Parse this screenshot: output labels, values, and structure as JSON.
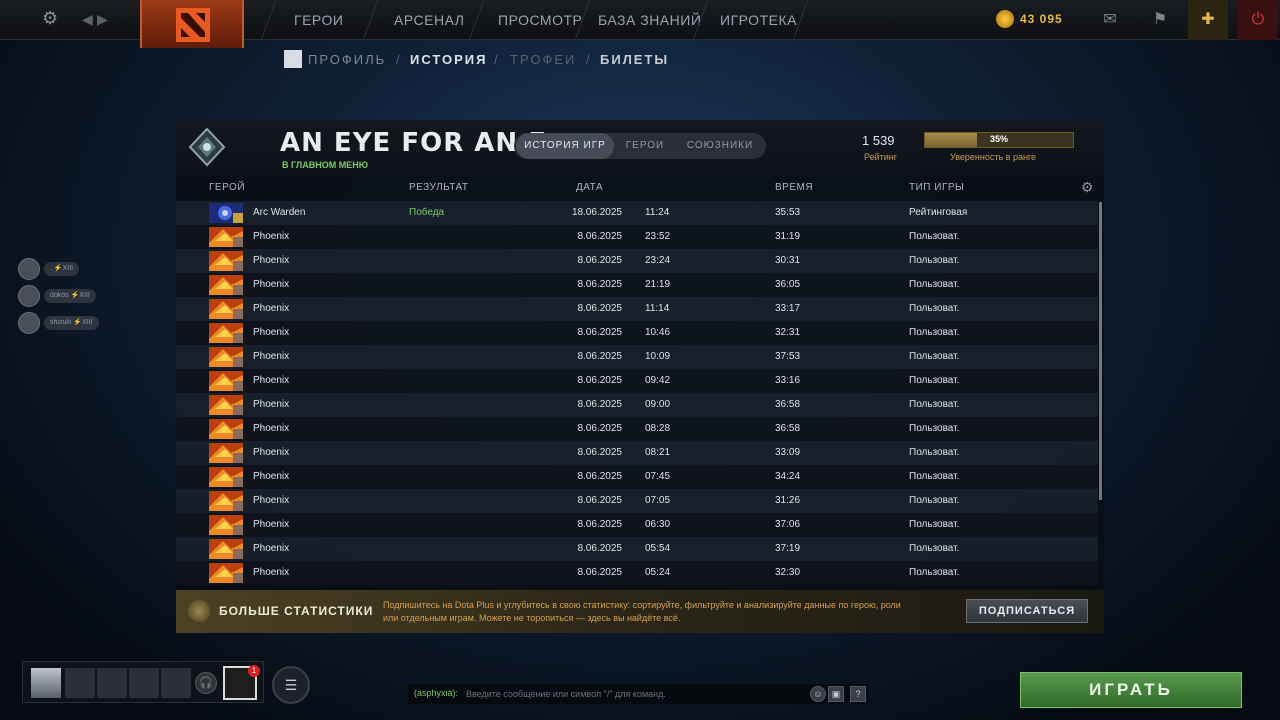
{
  "topbar": {
    "nav": [
      "ГЕРОИ",
      "АРСЕНАЛ",
      "ПРОСМОТР",
      "БАЗА ЗНАНИЙ",
      "ИГРОТЕКА"
    ],
    "shards": "43 095",
    "settings_icon": "gear-icon",
    "logo_icon": "dota-logo",
    "mail_icon": "mail-icon",
    "armory_icon": "banner-icon",
    "plus_icon": "dota-plus-icon",
    "power_icon": "power-icon"
  },
  "subnav": [
    "ПРОФИЛЬ",
    "/",
    "ИСТОРИЯ",
    "/",
    "ТРОФЕИ",
    "/",
    "БИЛЕТЫ"
  ],
  "profile": {
    "name": "AN EYE FOR AN E ...",
    "status": "В ГЛАВНОМ МЕНЮ",
    "tabs": [
      "ИСТОРИЯ ИГР",
      "ГЕРОИ",
      "СОЮЗНИКИ"
    ],
    "active_tab": 0,
    "rating_value": "1 539",
    "rating_label": "Рейтинг",
    "confidence_percent": 35,
    "confidence_text": "35%",
    "confidence_label": "Уверенность в ранге"
  },
  "table": {
    "headers": [
      "ГЕРОЙ",
      "РЕЗУЛЬТАТ",
      "ДАТА",
      "ВРЕМЯ",
      "ТИП ИГРЫ"
    ],
    "rows": [
      {
        "hero": "Arc Warden",
        "result": "Победа",
        "date": "18.06.2025",
        "time": "11:24",
        "duration": "35:53",
        "mode": "Рейтинговая"
      },
      {
        "hero": "Phoenix",
        "result": "",
        "date": "8.06.2025",
        "time": "23:52",
        "duration": "31:19",
        "mode": "Пользоват."
      },
      {
        "hero": "Phoenix",
        "result": "",
        "date": "8.06.2025",
        "time": "23:24",
        "duration": "30:31",
        "mode": "Пользоват."
      },
      {
        "hero": "Phoenix",
        "result": "",
        "date": "8.06.2025",
        "time": "21:19",
        "duration": "36:05",
        "mode": "Пользоват."
      },
      {
        "hero": "Phoenix",
        "result": "",
        "date": "8.06.2025",
        "time": "11:14",
        "duration": "33:17",
        "mode": "Пользоват."
      },
      {
        "hero": "Phoenix",
        "result": "",
        "date": "8.06.2025",
        "time": "10:46",
        "duration": "32:31",
        "mode": "Пользоват."
      },
      {
        "hero": "Phoenix",
        "result": "",
        "date": "8.06.2025",
        "time": "10:09",
        "duration": "37:53",
        "mode": "Пользоват."
      },
      {
        "hero": "Phoenix",
        "result": "",
        "date": "8.06.2025",
        "time": "09:42",
        "duration": "33:16",
        "mode": "Пользоват."
      },
      {
        "hero": "Phoenix",
        "result": "",
        "date": "8.06.2025",
        "time": "09:00",
        "duration": "36:58",
        "mode": "Пользоват."
      },
      {
        "hero": "Phoenix",
        "result": "",
        "date": "8.06.2025",
        "time": "08:28",
        "duration": "36:58",
        "mode": "Пользоват."
      },
      {
        "hero": "Phoenix",
        "result": "",
        "date": "8.06.2025",
        "time": "08:21",
        "duration": "33:09",
        "mode": "Пользоват."
      },
      {
        "hero": "Phoenix",
        "result": "",
        "date": "8.06.2025",
        "time": "07:45",
        "duration": "34:24",
        "mode": "Пользоват."
      },
      {
        "hero": "Phoenix",
        "result": "",
        "date": "8.06.2025",
        "time": "07:05",
        "duration": "31:26",
        "mode": "Пользоват."
      },
      {
        "hero": "Phoenix",
        "result": "",
        "date": "8.06.2025",
        "time": "06:30",
        "duration": "37:06",
        "mode": "Пользоват."
      },
      {
        "hero": "Phoenix",
        "result": "",
        "date": "8.06.2025",
        "time": "05:54",
        "duration": "37:19",
        "mode": "Пользоват."
      },
      {
        "hero": "Phoenix",
        "result": "",
        "date": "8.06.2025",
        "time": "05:24",
        "duration": "32:30",
        "mode": "Пользоват."
      }
    ]
  },
  "promo": {
    "title": "БОЛЬШЕ СТАТИСТИКИ",
    "text": "Подпишитесь на Dota Plus и углубитесь в свою статистику: сортируйте, фильтруйте и анализируйте данные по герою, роли или отдельным играм. Можете не торопиться — здесь вы найдёте всё.",
    "button": "ПОДПИСАТЬСЯ"
  },
  "friends": [
    {
      "name": ".",
      "level": "XIII"
    },
    {
      "name": "dokos",
      "level": "XIII"
    },
    {
      "name": "shizuki",
      "level": "XIII"
    }
  ],
  "bottom": {
    "notification_count": "1",
    "chat_user": "(asphyxia):",
    "chat_placeholder": "Введите сообщение или символ \"/\" для команд.",
    "help": "?",
    "play": "ИГРАТЬ"
  }
}
